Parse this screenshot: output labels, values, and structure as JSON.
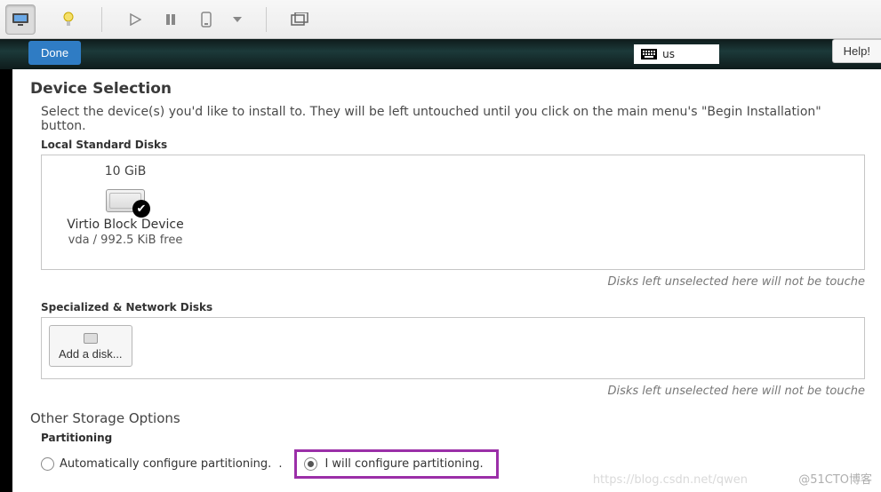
{
  "vm_toolbar": {
    "monitor": "monitor-icon",
    "bulb": "bulb-icon",
    "play": "play-icon",
    "pause": "pause-icon",
    "snapshot": "snapshot-icon",
    "fullscreen": "fullscreen-icon"
  },
  "header": {
    "done": "Done",
    "keyboard_layout": "us",
    "help": "Help!"
  },
  "device_selection": {
    "title": "Device Selection",
    "description": "Select the device(s) you'd like to install to.  They will be left untouched until you click on the main menu's \"Begin Installation\" button.",
    "local_disks_label": "Local Standard Disks",
    "disk": {
      "size": "10 GiB",
      "name": "Virtio Block Device",
      "free": "vda / 992.5 KiB free"
    },
    "hint": "Disks left unselected here will not be touche",
    "network_disks_label": "Specialized & Network Disks",
    "add_disk": "Add a disk...",
    "hint2": "Disks left unselected here will not be touche"
  },
  "other_storage": {
    "title": "Other Storage Options",
    "partitioning_label": "Partitioning",
    "auto": "Automatically configure partitioning.",
    "dot": ".",
    "manual": "I will configure partitioning."
  },
  "watermarks": {
    "w1": "@51CTO博客",
    "w2": "https://blog.csdn.net/qwen"
  }
}
